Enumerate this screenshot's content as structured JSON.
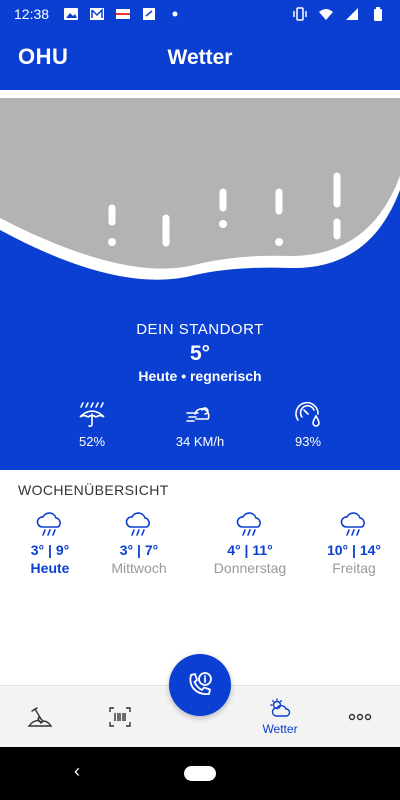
{
  "status_bar": {
    "time": "12:38",
    "notification_icons": [
      "image-icon",
      "mail-icon",
      "flag-icon",
      "document-icon",
      "dot-icon"
    ],
    "system_icons": [
      "vibrate-icon",
      "wifi-icon",
      "signal-icon",
      "battery-icon"
    ]
  },
  "header": {
    "logo": "OHU",
    "title": "Wetter"
  },
  "current": {
    "location_label": "DEIN STANDORT",
    "temperature": "5°",
    "description": "Heute • regnerisch",
    "stats": [
      {
        "icon": "umbrella-rain-icon",
        "value": "52%"
      },
      {
        "icon": "wind-icon",
        "value": "34 KM/h"
      },
      {
        "icon": "humidity-gauge-icon",
        "value": "93%"
      }
    ]
  },
  "week": {
    "title": "WOCHENÜBERSICHT",
    "days": [
      {
        "temps": "3° | 9°",
        "name": "Heute",
        "icon": "rain-cloud-icon"
      },
      {
        "temps": "3° | 7°",
        "name": "Mittwoch",
        "icon": "rain-cloud-icon"
      },
      {
        "temps": "4° | 11°",
        "name": "Donnerstag",
        "icon": "rain-cloud-icon"
      },
      {
        "temps": "10° | 14°",
        "name": "Freitag",
        "icon": "rain-cloud-icon"
      }
    ]
  },
  "bottom_nav": {
    "items": [
      {
        "icon": "shovel-icon",
        "label": ""
      },
      {
        "icon": "barcode-scan-icon",
        "label": ""
      },
      {
        "icon": "weather-icon",
        "label": "Wetter"
      },
      {
        "icon": "more-icon",
        "label": ""
      }
    ],
    "fab_icon": "phone-info-icon"
  },
  "colors": {
    "brand": "#0a3fd1",
    "cloud": "#b3b3b3",
    "muted_text": "#999999"
  }
}
